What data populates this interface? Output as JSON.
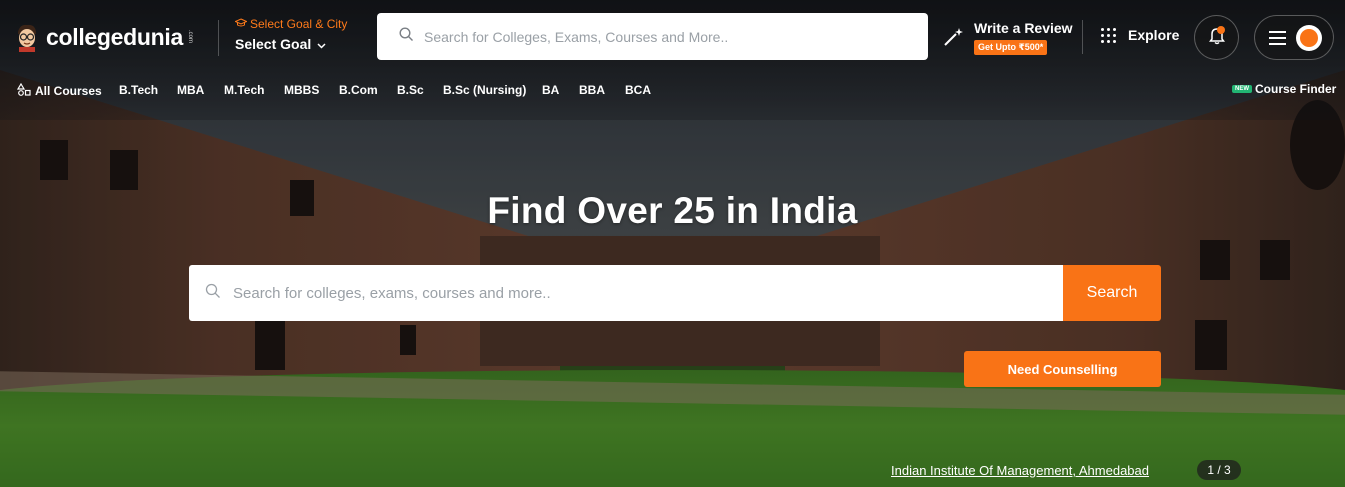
{
  "header": {
    "logo_text": "collegedunia",
    "logo_suffix": ".com",
    "goal_hint": "Select Goal & City",
    "goal_label": "Select Goal",
    "search_placeholder": "Search for Colleges, Exams, Courses and More..",
    "review_title": "Write a Review",
    "review_badge": "Get Upto ₹500*",
    "explore_label": "Explore"
  },
  "courses": {
    "items": [
      "All Courses",
      "B.Tech",
      "MBA",
      "M.Tech",
      "MBBS",
      "B.Com",
      "B.Sc",
      "B.Sc (Nursing)",
      "BA",
      "BBA",
      "BCA"
    ],
    "finder_badge": "NEW",
    "finder_label": "Course Finder"
  },
  "hero": {
    "title": "Find Over 25 in India",
    "search_placeholder": "Search for colleges, exams, courses and more..",
    "search_button": "Search",
    "counselling_button": "Need Counselling",
    "caption": "Indian Institute Of Management, Ahmedabad",
    "slide_counter": "1 / 3"
  },
  "colors": {
    "accent": "#f97316",
    "header_text": "#ffffff",
    "new_badge": "#22b573"
  },
  "icons": [
    "logo-mascot-icon",
    "graduation-cap-icon",
    "location-pin-icon",
    "chevron-down-icon",
    "search-icon",
    "magic-wand-icon",
    "grid-dots-icon",
    "bell-icon",
    "hamburger-menu-icon",
    "user-avatar-icon",
    "shapes-icon"
  ]
}
